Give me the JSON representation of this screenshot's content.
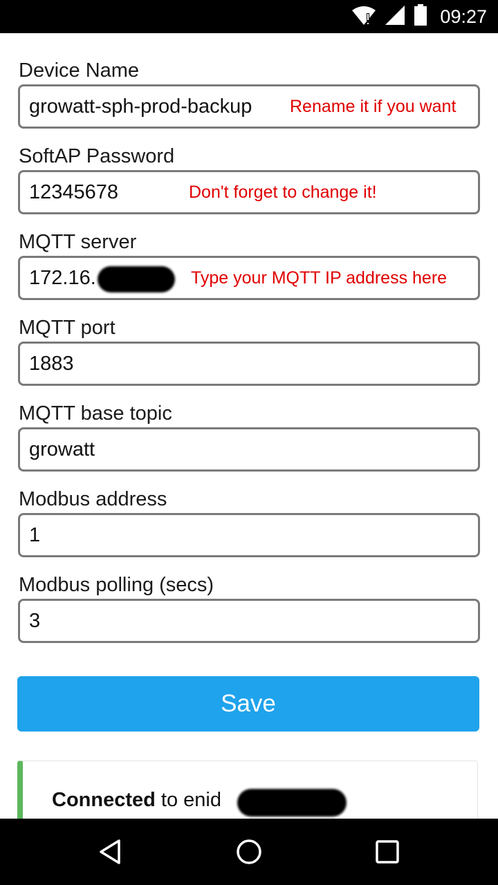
{
  "status_bar": {
    "time": "09:27",
    "icons": [
      "wifi-alert-icon",
      "cell-signal-icon",
      "battery-icon"
    ]
  },
  "form": {
    "fields": [
      {
        "label": "Device Name",
        "value": "growatt-sph-prod-backup",
        "note": "Rename it if you want"
      },
      {
        "label": "SoftAP Password",
        "value": "12345678",
        "note": "Don't forget to change it!"
      },
      {
        "label": "MQTT server",
        "value": "172.16.",
        "note": "Type your MQTT IP address here",
        "redacted": true
      },
      {
        "label": "MQTT port",
        "value": "1883"
      },
      {
        "label": "MQTT base topic",
        "value": "growatt"
      },
      {
        "label": "Modbus address",
        "value": "1"
      },
      {
        "label": "Modbus polling (secs)",
        "value": "3"
      }
    ],
    "save_label": "Save"
  },
  "status_card": {
    "bold": "Connected",
    "text": " to enid",
    "accent_color": "#5cb85c"
  },
  "nav_bar": {
    "icons": [
      "back-icon",
      "home-icon",
      "recents-icon"
    ]
  },
  "colors": {
    "accent": "#1fa3ec",
    "note": "#e00000"
  }
}
